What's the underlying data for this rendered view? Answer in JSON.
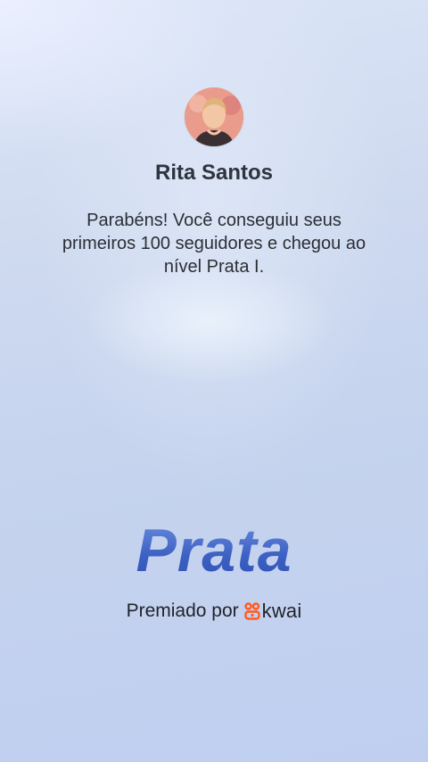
{
  "profile": {
    "name": "Rita Santos"
  },
  "message": {
    "text": "Parabéns! Você conseguiu seus primeiros 100 seguidores e chegou ao nível Prata I."
  },
  "badge": {
    "level_title": "Prata"
  },
  "footer": {
    "awarded_by_label": "Premiado por",
    "brand_name": "kwai",
    "brand_icon": "kwai-logo-icon"
  },
  "colors": {
    "level_title": "#3f66c9",
    "brand_icon": "#ff5a1f",
    "name_text": "#2e3440"
  }
}
